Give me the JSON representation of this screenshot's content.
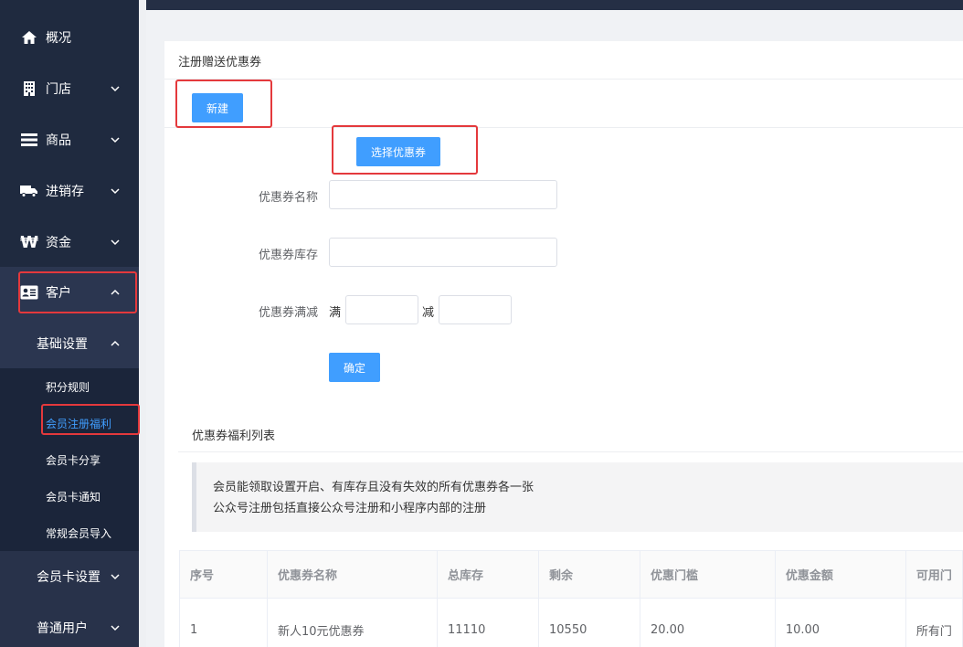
{
  "sidebar": {
    "items": [
      {
        "label": "概况",
        "icon": "home-icon"
      },
      {
        "label": "门店",
        "icon": "building-icon"
      },
      {
        "label": "商品",
        "icon": "menu-lines-icon"
      },
      {
        "label": "进销存",
        "icon": "truck-icon"
      },
      {
        "label": "资金",
        "icon": "won-icon"
      },
      {
        "label": "客户",
        "icon": "id-card-icon"
      }
    ],
    "sub_basic": "基础设置",
    "leaves": [
      "积分规则",
      "会员注册福利",
      "会员卡分享",
      "会员卡通知",
      "常规会员导入"
    ],
    "sub_member_card": "会员卡设置",
    "sub_normal_user": "普通用户"
  },
  "page": {
    "title": "注册赠送优惠券",
    "new_button": "新建",
    "select_coupon_button": "选择优惠券",
    "form": {
      "name_label": "优惠券名称",
      "stock_label": "优惠券库存",
      "threshold_label": "优惠券满减",
      "full_text": "满",
      "minus_text": "减",
      "confirm_button": "确定"
    },
    "list_title": "优惠券福利列表",
    "notice_lines": [
      "会员能领取设置开启、有库存且没有失效的所有优惠券各一张",
      "公众号注册包括直接公众号注册和小程序内部的注册"
    ],
    "table": {
      "headers": [
        "序号",
        "优惠券名称",
        "总库存",
        "剩余",
        "优惠门槛",
        "优惠金额",
        "可用门"
      ],
      "rows": [
        [
          "1",
          "新人10元优惠券",
          "11110",
          "10550",
          "20.00",
          "10.00",
          "所有门"
        ]
      ]
    }
  },
  "colors": {
    "sidebar_bg": "#1f2a3f",
    "accent": "#409eff",
    "highlight_box": "#e4393c"
  }
}
